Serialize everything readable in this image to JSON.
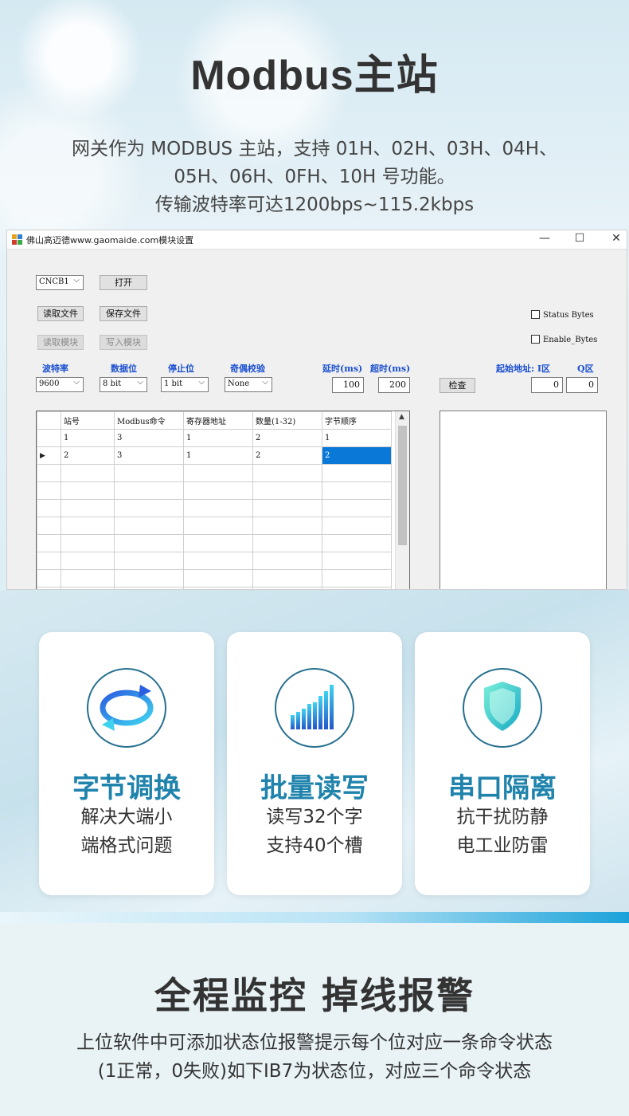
{
  "hero": {
    "title": "Modbus主站",
    "desc_line1": "网关作为 MODBUS 主站，支持 01H、02H、03H、04H、",
    "desc_line2": "05H、06H、0FH、10H 号功能。",
    "desc_line3": "传输波特率可达1200bps~115.2kbps"
  },
  "window": {
    "title": "佛山高迈德www.gaomaide.com模块设置",
    "minimize": "—",
    "maximize": "☐",
    "close": "✕",
    "port_value": "CNCB1",
    "open_button": "打开",
    "read_file_button": "读取文件",
    "save_file_button": "保存文件",
    "read_module_button": "读取模块",
    "write_module_button": "写入模块",
    "status_bytes_label": "Status Bytes",
    "enable_bytes_label": "Enable_Bytes",
    "baud_label": "波特率",
    "databits_label": "数据位",
    "stopbits_label": "停止位",
    "parity_label": "奇偶校验",
    "delay_label": "延时(ms)",
    "timeout_label": "超时(ms)",
    "start_addr_label": "起始地址: I区",
    "q_area_label": "Q区",
    "baud_value": "9600",
    "databits_value": "8 bit",
    "stopbits_value": "1 bit",
    "parity_value": "None",
    "delay_value": "100",
    "timeout_value": "200",
    "check_button": "检查",
    "i_area_value": "0",
    "q_area_value": "0",
    "grid": {
      "headers": [
        "站号",
        "Modbus命令",
        "寄存器地址",
        "数量(1-32)",
        "字节顺序"
      ],
      "rows": [
        [
          "1",
          "3",
          "1",
          "2",
          "1"
        ],
        [
          "2",
          "3",
          "1",
          "2",
          "2"
        ]
      ],
      "current_row_marker": "▶"
    }
  },
  "features": [
    {
      "title": "字节调换",
      "line1": "解决大端小",
      "line2": "端格式问题",
      "icon": "swap-cycle-icon"
    },
    {
      "title": "批量读写",
      "line1": "读写32个字",
      "line2": "支持40个槽",
      "icon": "bar-chart-icon"
    },
    {
      "title": "串口隔离",
      "line1": "抗干扰防静",
      "line2": "电工业防雷",
      "icon": "shield-icon"
    }
  ],
  "bottom": {
    "title": "全程监控 掉线报警",
    "line1": "上位软件中可添加状态位报警提示每个位对应一条命令状态",
    "line2": "(1正常，0失败)如下IB7为状态位，对应三个命令状态"
  },
  "colors": {
    "feature_title": "#1f83ac",
    "selection": "#0a78d7",
    "label_blue": "#1a4fd0"
  }
}
